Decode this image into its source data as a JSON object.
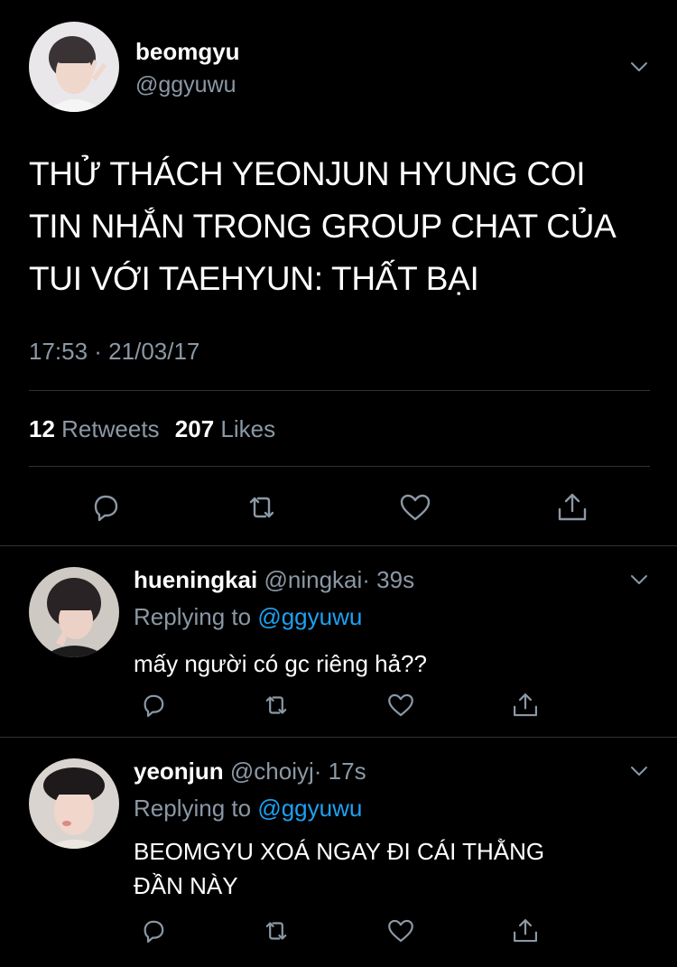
{
  "main_tweet": {
    "display_name": "beomgyu",
    "handle": "@ggyuwu",
    "text_lines": [
      "THỬ THÁCH YEONJUN HYUNG COI",
      "TIN NHẮN TRONG GROUP CHAT CỦA",
      "TUI VỚI TAEHYUN: THẤT BẠI"
    ],
    "timestamp": "17:53 · 21/03/17",
    "retweets_count": "12",
    "retweets_label": "Retweets",
    "likes_count": "207",
    "likes_label": "Likes"
  },
  "replies": [
    {
      "display_name": "hueningkai",
      "handle": "@ningkai",
      "time": "· 39s",
      "replying_prefix": "Replying to",
      "replying_handle": "@ggyuwu",
      "text_lines": [
        "mấy người có gc riêng hả??"
      ]
    },
    {
      "display_name": "yeonjun",
      "handle": "@choiyj",
      "time": "· 17s",
      "replying_prefix": "Replying to",
      "replying_handle": "@ggyuwu",
      "text_lines": [
        "BEOMGYU XOÁ NGAY ĐI CÁI THẰNG",
        "ĐẦN NÀY"
      ]
    }
  ],
  "colors": {
    "background": "#000000",
    "text": "#ffffff",
    "muted": "#8b98a5",
    "link": "#1da1f2",
    "divider": "#2f3336"
  }
}
